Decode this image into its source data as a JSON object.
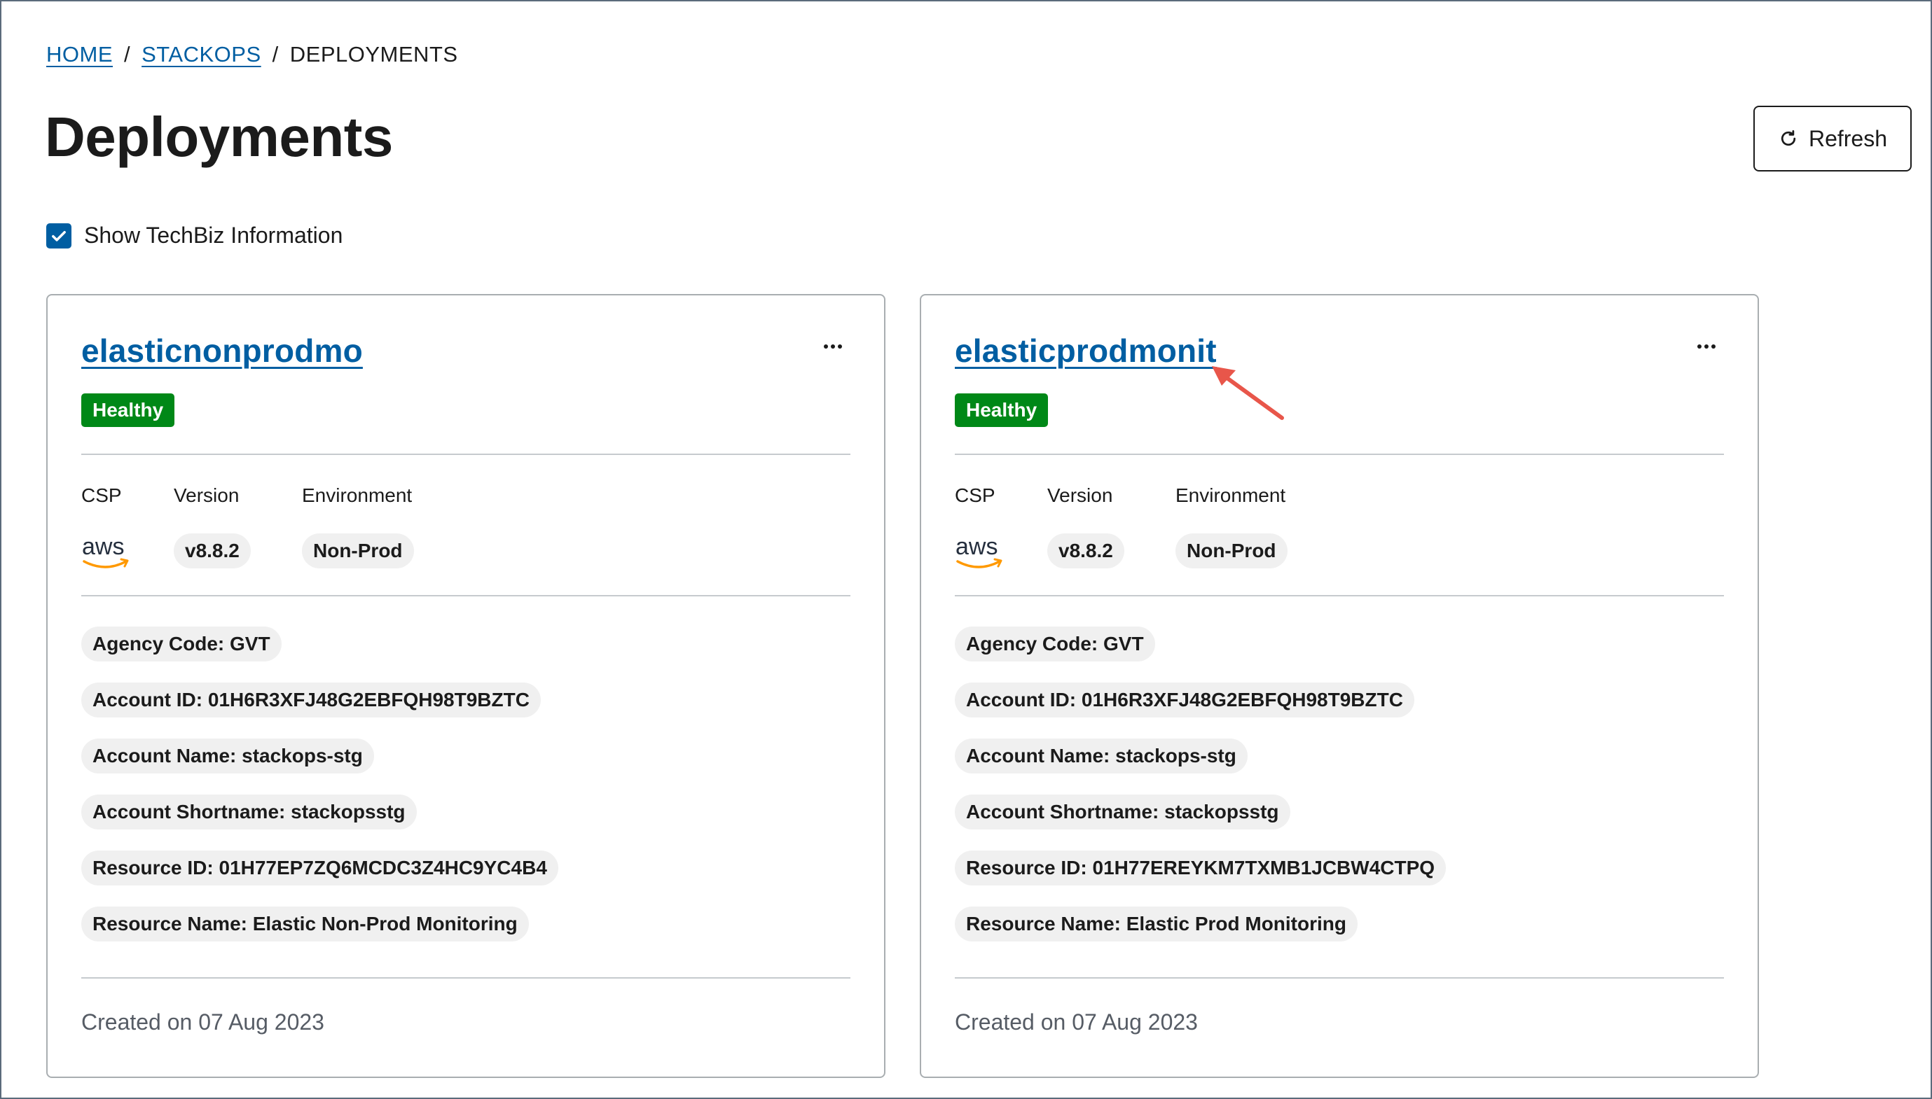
{
  "breadcrumb": {
    "home": "HOME",
    "stackops": "STACKOPS",
    "separator": "/",
    "current": "DEPLOYMENTS"
  },
  "page": {
    "title": "Deployments",
    "refresh_label": "Refresh",
    "refresh_icon": "refresh-icon",
    "show_techbiz_label": "Show TechBiz Information",
    "show_techbiz_checked": true
  },
  "labels": {
    "csp": "CSP",
    "version": "Version",
    "environment": "Environment"
  },
  "deployments": [
    {
      "name": "elasticnonprodmo",
      "status": "Healthy",
      "csp_icon": "aws-logo",
      "csp_text": "aws",
      "version": "v8.8.2",
      "environment": "Non-Prod",
      "agency_code": "Agency Code: GVT",
      "account_id": "Account ID: 01H6R3XFJ48G2EBFQH98T9BZTC",
      "account_name": "Account Name: stackops-stg",
      "account_shortname": "Account Shortname: stackopsstg",
      "resource_id": "Resource ID: 01H77EP7ZQ6MCDC3Z4HC9YC4B4",
      "resource_name": "Resource Name: Elastic Non-Prod Monitoring",
      "created": "Created on 07 Aug 2023"
    },
    {
      "name": "elasticprodmonit",
      "status": "Healthy",
      "csp_icon": "aws-logo",
      "csp_text": "aws",
      "version": "v8.8.2",
      "environment": "Non-Prod",
      "agency_code": "Agency Code: GVT",
      "account_id": "Account ID: 01H6R3XFJ48G2EBFQH98T9BZTC",
      "account_name": "Account Name: stackops-stg",
      "account_shortname": "Account Shortname: stackopsstg",
      "resource_id": "Resource ID: 01H77EREYKM7TXMB1JCBW4CTPQ",
      "resource_name": "Resource Name: Elastic Prod Monitoring",
      "created": "Created on 07 Aug 2023"
    }
  ],
  "colors": {
    "link": "#005ea2",
    "healthy": "#008817",
    "chip_bg": "#f0f0f0",
    "annotation_arrow": "#e8564a"
  }
}
